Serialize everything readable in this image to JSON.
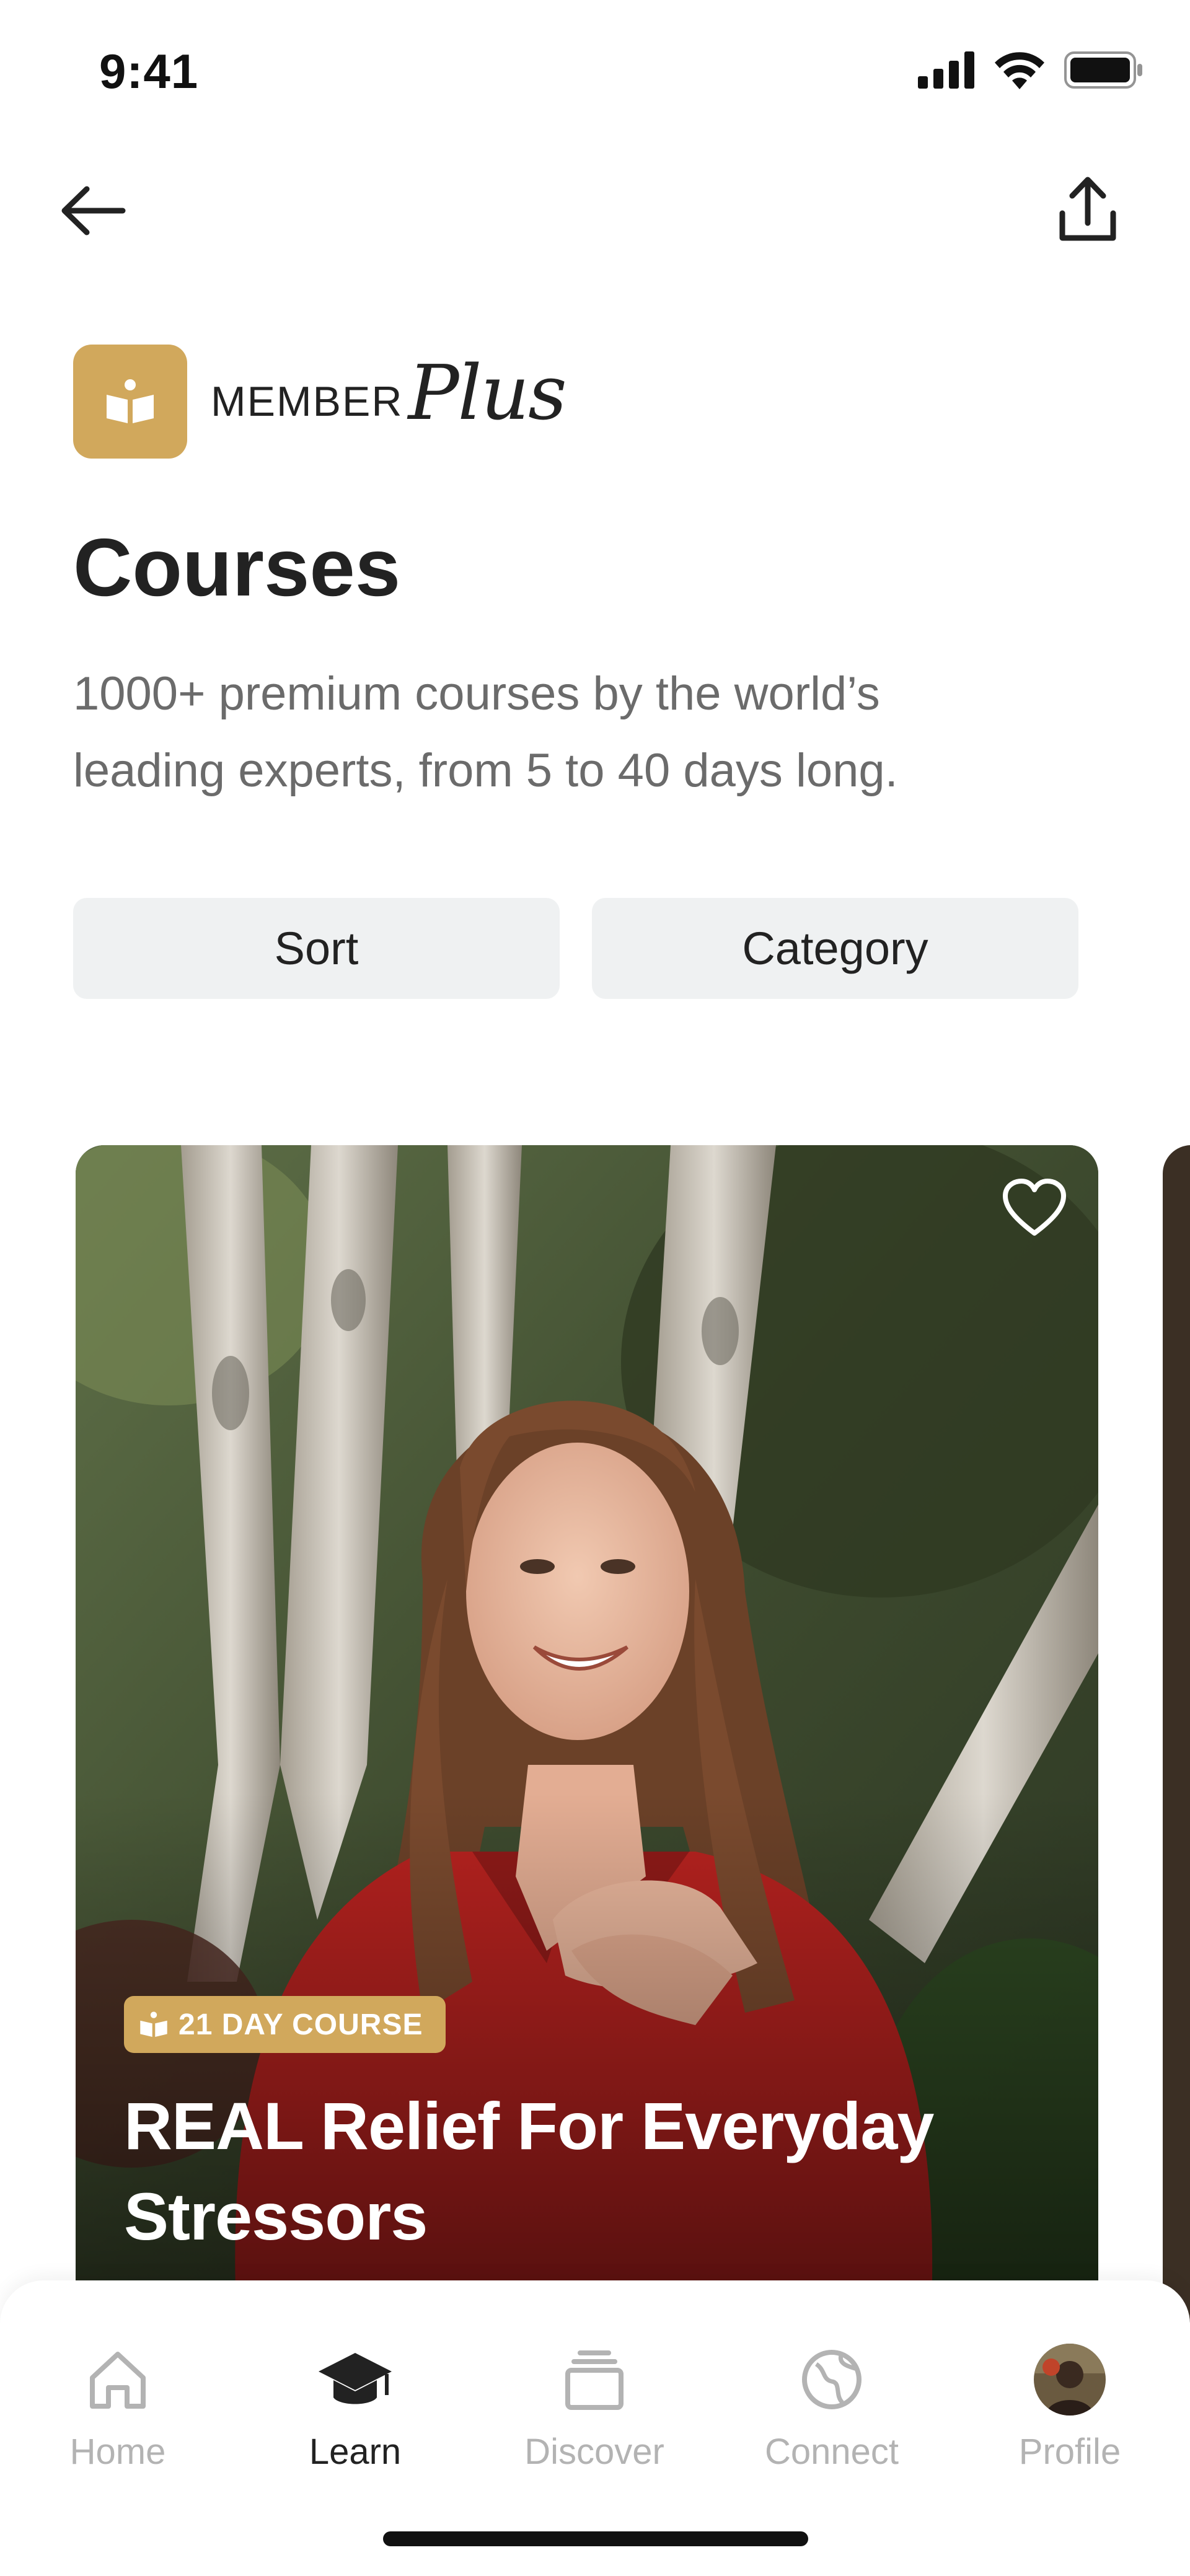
{
  "status_bar": {
    "time": "9:41"
  },
  "nav": {
    "back_icon": "arrow-left-icon",
    "share_icon": "share-icon"
  },
  "brand": {
    "badge_icon": "book-icon",
    "member_text": "MEMBER",
    "plus_text": "Plus",
    "accent_color": "#d1a85c"
  },
  "page": {
    "title": "Courses",
    "subtitle": "1000+ premium courses by the world’s leading experts, from 5 to 40 days long."
  },
  "filters": {
    "sort_label": "Sort",
    "category_label": "Category"
  },
  "course_card": {
    "badge_label": "21 DAY COURSE",
    "title": "REAL Relief For Everyday Stressors",
    "favorite_icon": "heart-icon"
  },
  "tab_bar": {
    "tabs": [
      {
        "label": "Home",
        "icon": "home-icon",
        "active": false
      },
      {
        "label": "Learn",
        "icon": "graduation-cap-icon",
        "active": true
      },
      {
        "label": "Discover",
        "icon": "stack-icon",
        "active": false
      },
      {
        "label": "Connect",
        "icon": "globe-icon",
        "active": false
      },
      {
        "label": "Profile",
        "icon": "avatar-icon",
        "active": false
      }
    ]
  }
}
